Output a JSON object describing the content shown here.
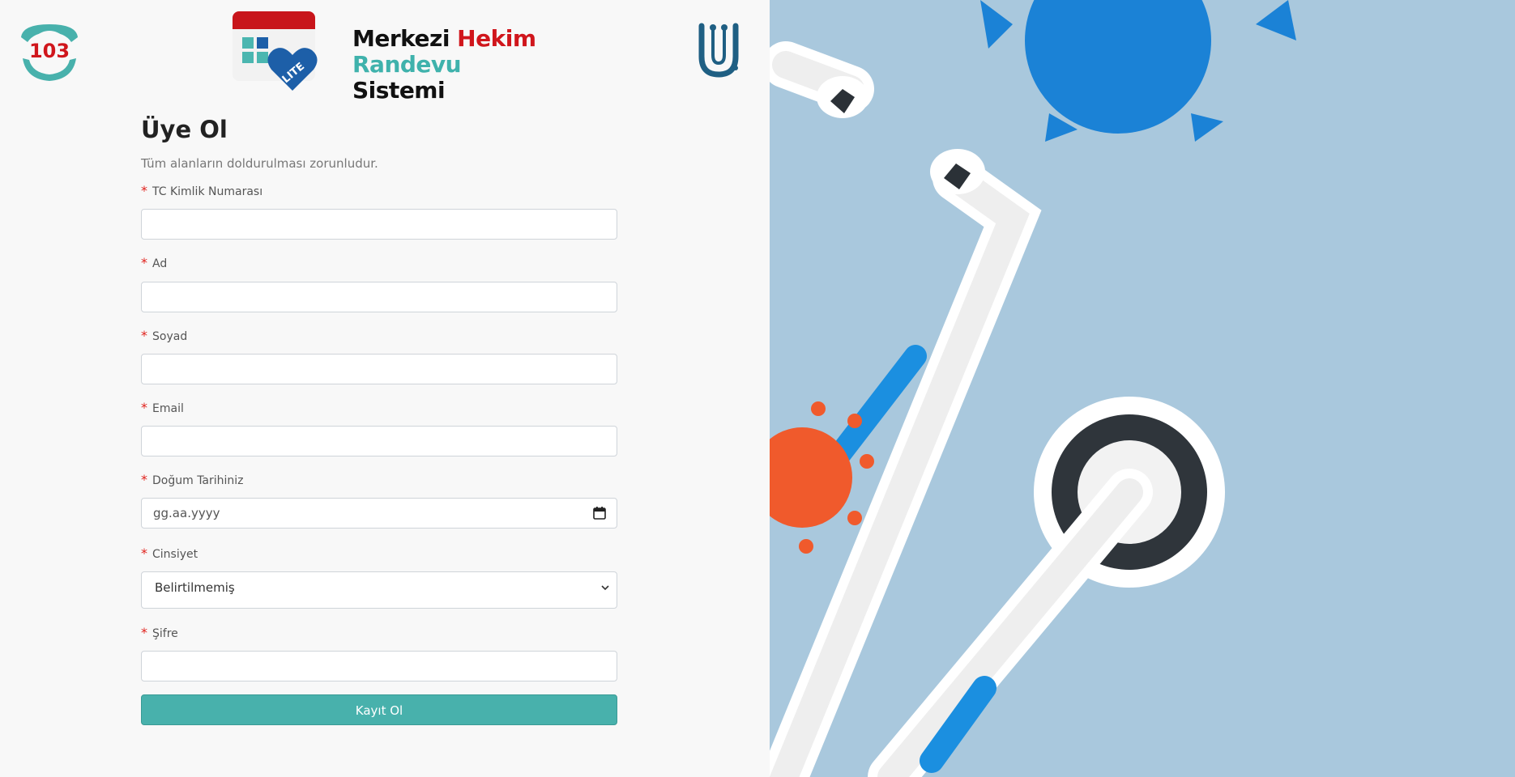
{
  "logos": {
    "hotline": "103",
    "brand_line1_a": "Merkezi",
    "brand_line1_b": "Hekim",
    "brand_line2_a": "Randevu",
    "brand_line2_b": "Sistemi",
    "badge": "LITE",
    "right_logo_letter": "U"
  },
  "form": {
    "title": "Üye Ol",
    "subtitle": "Tüm alanların doldurulması zorunludur.",
    "required_marker": "*",
    "fields": {
      "tc": {
        "label": "TC Kimlik Numarası",
        "value": ""
      },
      "ad": {
        "label": "Ad",
        "value": ""
      },
      "soyad": {
        "label": "Soyad",
        "value": ""
      },
      "email": {
        "label": "Email",
        "value": ""
      },
      "dogum": {
        "label": "Doğum Tarihiniz",
        "placeholder": "gg.aa.yyyy"
      },
      "cinsiyet": {
        "label": "Cinsiyet",
        "selected": "Belirtilmemiş"
      },
      "sifre": {
        "label": "Şifre",
        "value": ""
      }
    },
    "submit_label": "Kayıt Ol"
  },
  "colors": {
    "accent_teal": "#48b1ac",
    "required_red": "#e0221c",
    "brand_red": "#d0161c",
    "right_pane_bg": "#a9c8dd"
  },
  "icons": {
    "date": "calendar-icon",
    "select": "chevron-down-icon",
    "illustration": "stethoscope-virus-illustration"
  }
}
